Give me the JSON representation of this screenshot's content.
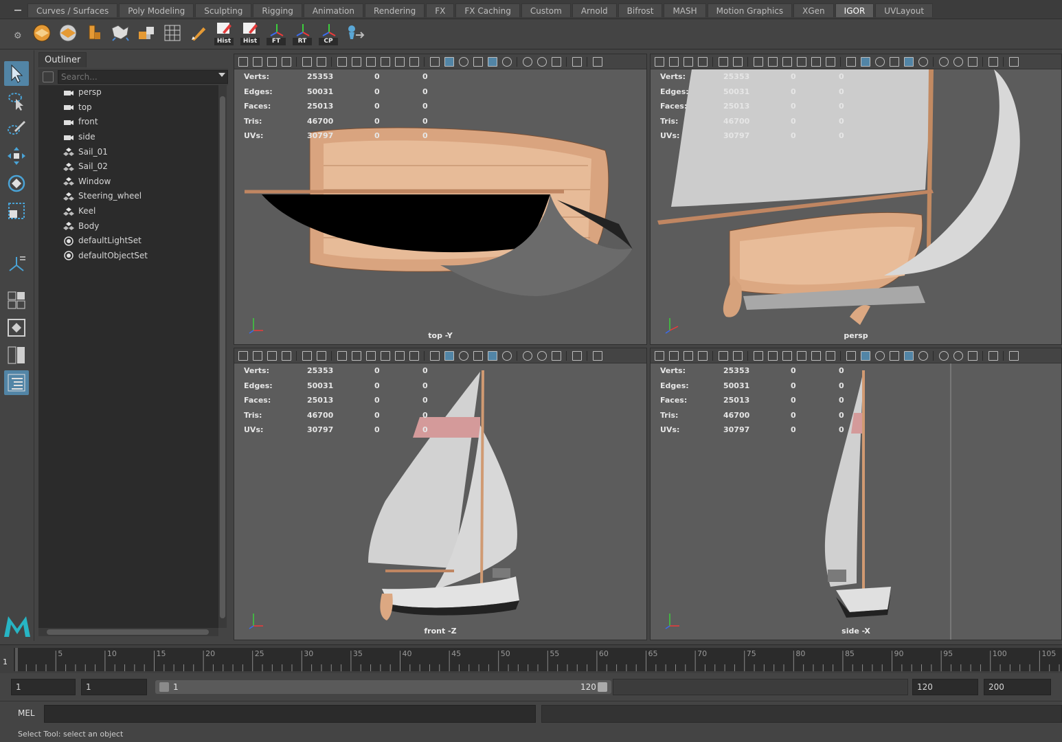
{
  "shelf": {
    "tabs": [
      "Curves / Surfaces",
      "Poly Modeling",
      "Sculpting",
      "Rigging",
      "Animation",
      "Rendering",
      "FX",
      "FX Caching",
      "Custom",
      "Arnold",
      "Bifrost",
      "MASH",
      "Motion Graphics",
      "XGen",
      "IGOR",
      "UVLayout"
    ],
    "active_tab": "IGOR",
    "labeled_buttons": [
      "Hist",
      "Hist",
      "FT",
      "RT",
      "CP"
    ]
  },
  "outliner": {
    "tab_label": "Outliner",
    "search_placeholder": "Search...",
    "items": [
      {
        "label": "persp",
        "icon": "camera-icon"
      },
      {
        "label": "top",
        "icon": "camera-icon"
      },
      {
        "label": "front",
        "icon": "camera-icon"
      },
      {
        "label": "side",
        "icon": "camera-icon"
      },
      {
        "label": "Sail_01",
        "icon": "transform-icon"
      },
      {
        "label": "Sail_02",
        "icon": "transform-icon"
      },
      {
        "label": "Window",
        "icon": "transform-icon"
      },
      {
        "label": "Steering_wheel",
        "icon": "transform-icon"
      },
      {
        "label": "Keel",
        "icon": "transform-icon"
      },
      {
        "label": "Body",
        "icon": "transform-icon"
      },
      {
        "label": "defaultLightSet",
        "icon": "set-icon"
      },
      {
        "label": "defaultObjectSet",
        "icon": "set-icon"
      }
    ]
  },
  "stats": {
    "labels": [
      "Verts:",
      "Edges:",
      "Faces:",
      "Tris:",
      "UVs:"
    ],
    "values": [
      "25353",
      "50031",
      "25013",
      "46700",
      "30797"
    ],
    "selected": [
      "0",
      "0",
      "0",
      "0",
      "0"
    ],
    "components": [
      "0",
      "0",
      "0",
      "0",
      "0"
    ]
  },
  "viewports": {
    "top_left": "top -Y",
    "top_right": "persp",
    "bottom_left": "front -Z",
    "bottom_right": "side -X"
  },
  "timeline": {
    "ticks": [
      "5",
      "10",
      "15",
      "20",
      "25",
      "30",
      "35",
      "40",
      "45",
      "50",
      "55",
      "60",
      "65",
      "70",
      "75",
      "80",
      "85",
      "90",
      "95",
      "100",
      "105"
    ],
    "current_frame": "1"
  },
  "range": {
    "start_time": "1",
    "playback_start": "1",
    "slider_start": "1",
    "slider_end": "120",
    "playback_end": "120",
    "end_time": "200"
  },
  "command_line": {
    "language": "MEL"
  },
  "help_line": {
    "text": "Select Tool: select an object"
  },
  "colors": {
    "accent": "#5285a6",
    "wood": "#e0b08c",
    "sail": "#d4d4d4",
    "viewport_bg": "#5c5c5c"
  }
}
